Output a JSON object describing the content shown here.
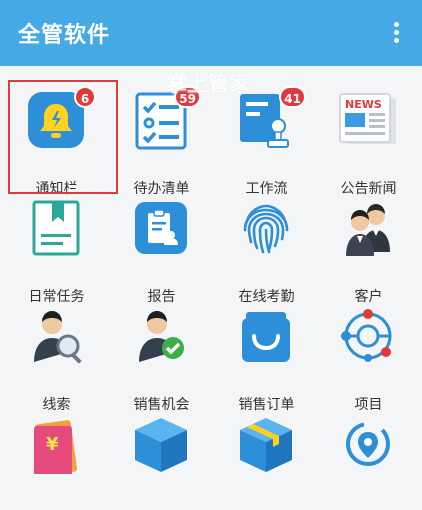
{
  "app": {
    "title": "全管软件"
  },
  "watermark": "掌上管家",
  "colors": {
    "appbar": "#45a9e6",
    "badge": "#e3393c",
    "highlight": "#e03a3a"
  },
  "tiles": [
    {
      "label": "通知栏",
      "icon": "bell-icon",
      "badge": "6"
    },
    {
      "label": "待办清单",
      "icon": "checklist-icon",
      "badge": "59"
    },
    {
      "label": "工作流",
      "icon": "approval-stamp-icon",
      "badge": "41"
    },
    {
      "label": "公告新闻",
      "icon": "news-icon",
      "badge": ""
    },
    {
      "label": "日常任务",
      "icon": "bookmark-document-icon",
      "badge": ""
    },
    {
      "label": "报告",
      "icon": "report-icon",
      "badge": ""
    },
    {
      "label": "在线考勤",
      "icon": "fingerprint-icon",
      "badge": ""
    },
    {
      "label": "客户",
      "icon": "customers-icon",
      "badge": ""
    },
    {
      "label": "线索",
      "icon": "lead-search-icon",
      "badge": ""
    },
    {
      "label": "销售机会",
      "icon": "sales-opportunity-icon",
      "badge": ""
    },
    {
      "label": "销售订单",
      "icon": "shopping-bag-icon",
      "badge": ""
    },
    {
      "label": "项目",
      "icon": "project-network-icon",
      "badge": ""
    },
    {
      "label": "",
      "icon": "coupon-icon",
      "badge": ""
    },
    {
      "label": "",
      "icon": "box-icon",
      "badge": ""
    },
    {
      "label": "",
      "icon": "package-icon",
      "badge": ""
    },
    {
      "label": "",
      "icon": "location-cycle-icon",
      "badge": ""
    }
  ]
}
